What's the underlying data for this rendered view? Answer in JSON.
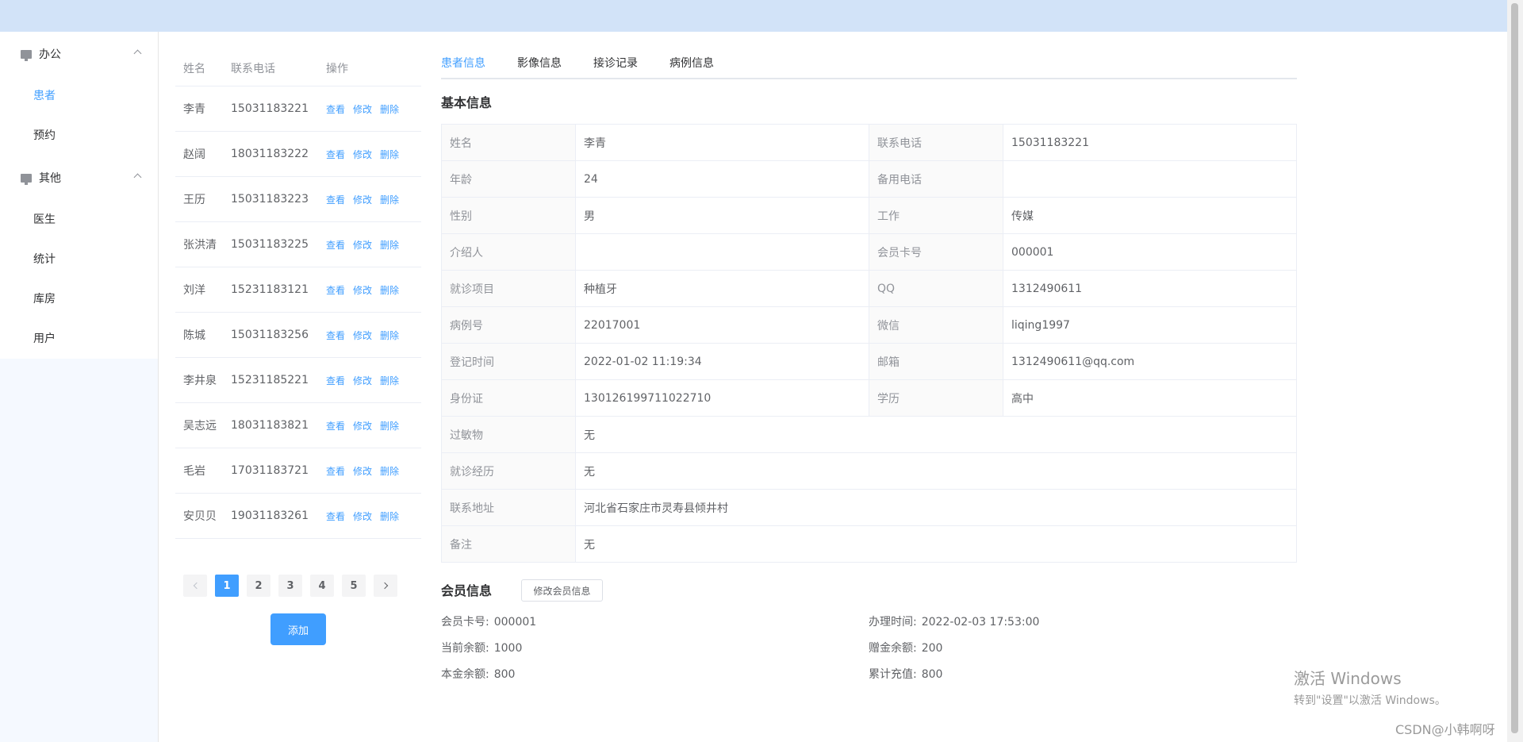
{
  "sidebar": {
    "groups": [
      {
        "title": "办公",
        "items": [
          {
            "label": "患者"
          },
          {
            "label": "预约"
          }
        ]
      },
      {
        "title": "其他",
        "items": [
          {
            "label": "医生"
          },
          {
            "label": "统计"
          },
          {
            "label": "库房"
          },
          {
            "label": "用户"
          }
        ]
      }
    ]
  },
  "patient_list": {
    "headers": {
      "name": "姓名",
      "phone": "联系电话",
      "ops": "操作"
    },
    "op_labels": {
      "view": "查看",
      "edit": "修改",
      "delete": "删除"
    },
    "rows": [
      {
        "name": "李青",
        "phone": "15031183221"
      },
      {
        "name": "赵阔",
        "phone": "18031183222"
      },
      {
        "name": "王历",
        "phone": "15031183223"
      },
      {
        "name": "张洪清",
        "phone": "15031183225"
      },
      {
        "name": "刘洋",
        "phone": "15231183121"
      },
      {
        "name": "陈城",
        "phone": "15031183256"
      },
      {
        "name": "李井泉",
        "phone": "15231185221"
      },
      {
        "name": "吴志远",
        "phone": "18031183821"
      },
      {
        "name": "毛岩",
        "phone": "17031183721"
      },
      {
        "name": "安贝贝",
        "phone": "19031183261"
      }
    ],
    "pages": [
      "1",
      "2",
      "3",
      "4",
      "5"
    ],
    "current_page": "1",
    "add_label": "添加"
  },
  "tabs": [
    {
      "label": "患者信息"
    },
    {
      "label": "影像信息"
    },
    {
      "label": "接诊记录"
    },
    {
      "label": "病例信息"
    }
  ],
  "basic_info": {
    "title": "基本信息",
    "rows": [
      {
        "l1": "姓名",
        "v1": "李青",
        "l2": "联系电话",
        "v2": "15031183221"
      },
      {
        "l1": "年龄",
        "v1": "24",
        "l2": "备用电话",
        "v2": ""
      },
      {
        "l1": "性别",
        "v1": "男",
        "l2": "工作",
        "v2": "传媒"
      },
      {
        "l1": "介绍人",
        "v1": "",
        "l2": "会员卡号",
        "v2": "000001"
      },
      {
        "l1": "就诊项目",
        "v1": "种植牙",
        "l2": "QQ",
        "v2": "1312490611"
      },
      {
        "l1": "病例号",
        "v1": "22017001",
        "l2": "微信",
        "v2": "liqing1997"
      },
      {
        "l1": "登记时间",
        "v1": "2022-01-02 11:19:34",
        "l2": "邮箱",
        "v2": "1312490611@qq.com"
      },
      {
        "l1": "身份证",
        "v1": "130126199711022710",
        "l2": "学历",
        "v2": "高中"
      }
    ],
    "wide_rows": [
      {
        "l": "过敏物",
        "v": "无"
      },
      {
        "l": "就诊经历",
        "v": "无"
      },
      {
        "l": "联系地址",
        "v": "河北省石家庄市灵寿县倾井村"
      },
      {
        "l": "备注",
        "v": "无"
      }
    ]
  },
  "member_info": {
    "title": "会员信息",
    "edit_label": "修改会员信息",
    "card_no_label": "会员卡号:",
    "card_no": "000001",
    "handle_time_label": "办理时间:",
    "handle_time": "2022-02-03 17:53:00",
    "balance_label": "当前余额:",
    "balance": "1000",
    "gift_label": "赠金余额:",
    "gift": "200",
    "principal_label": "本金余额:",
    "principal": "800",
    "total_label": "累计充值:",
    "total": "800"
  },
  "watermark": {
    "line1": "激活 Windows",
    "line2": "转到\"设置\"以激活 Windows。"
  },
  "credit": "CSDN@小韩啊呀",
  "colors": {
    "accent": "#409eff",
    "topbar": "#d2e3f8",
    "sidebar_bg": "#f5f9ff"
  }
}
